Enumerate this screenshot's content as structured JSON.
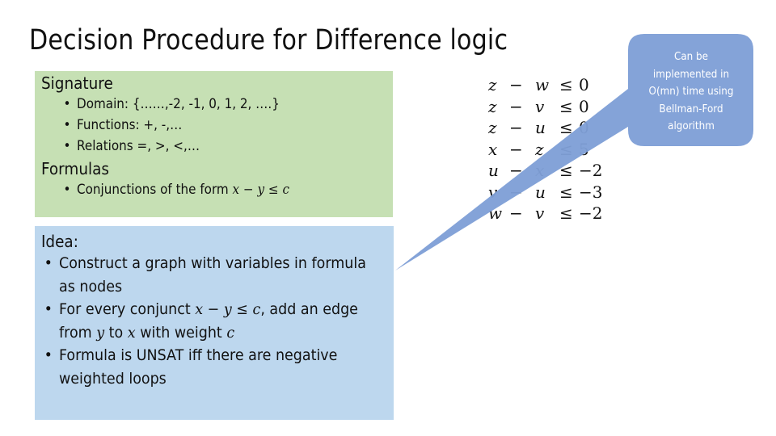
{
  "title": "Decision Procedure for Difference logic",
  "signature_box": {
    "heading": "Signature",
    "items": [
      "Domain: {……,-2, -1, 0, 1, 2, ….}",
      "Functions:  +, -,…",
      "Relations  =, >, <,…"
    ],
    "formulas_heading": "Formulas",
    "formulas_prefix": "Conjunctions of the form ",
    "formulas_math": {
      "x": "x",
      "minus": "−",
      "y": "y",
      "le": "≤",
      "c": "c"
    },
    "background": "#c6e0b4"
  },
  "idea_box": {
    "heading": "Idea:",
    "item1": "Construct a graph with variables in formula as nodes",
    "item2": {
      "prefix": "For every conjunct ",
      "x": "x",
      "minus": "−",
      "y": "y",
      "le": "≤",
      "c": "c",
      "mid": ", add an edge from ",
      "y2": "y",
      "to": " to ",
      "x2": "x",
      "with": " with weight ",
      "c2": "c"
    },
    "item3": "Formula is UNSAT iff there are negative weighted loops",
    "background": "#bdd7ee"
  },
  "constraints": [
    {
      "lhs": "z",
      "minus": "−",
      "rhs": "w",
      "le": "≤",
      "const": "0"
    },
    {
      "lhs": "z",
      "minus": "−",
      "rhs": "v",
      "le": "≤",
      "const": "0"
    },
    {
      "lhs": "z",
      "minus": "−",
      "rhs": "u",
      "le": "≤",
      "const": "0"
    },
    {
      "lhs": "x",
      "minus": "−",
      "rhs": "z",
      "le": "≤",
      "const": "5"
    },
    {
      "lhs": "u",
      "minus": "−",
      "rhs": "x",
      "le": "≤",
      "const": "−2"
    },
    {
      "lhs": "v",
      "minus": "−",
      "rhs": "u",
      "le": "≤",
      "const": "−3"
    },
    {
      "lhs": "w",
      "minus": "−",
      "rhs": "v",
      "le": "≤",
      "const": "−2"
    }
  ],
  "callout": {
    "lines": [
      "Can be",
      "implemented in",
      "O(mn) time using",
      "Bellman-Ford",
      "algorithm"
    ],
    "fill": "#7f9fd6",
    "text_color": "#ffffff"
  }
}
